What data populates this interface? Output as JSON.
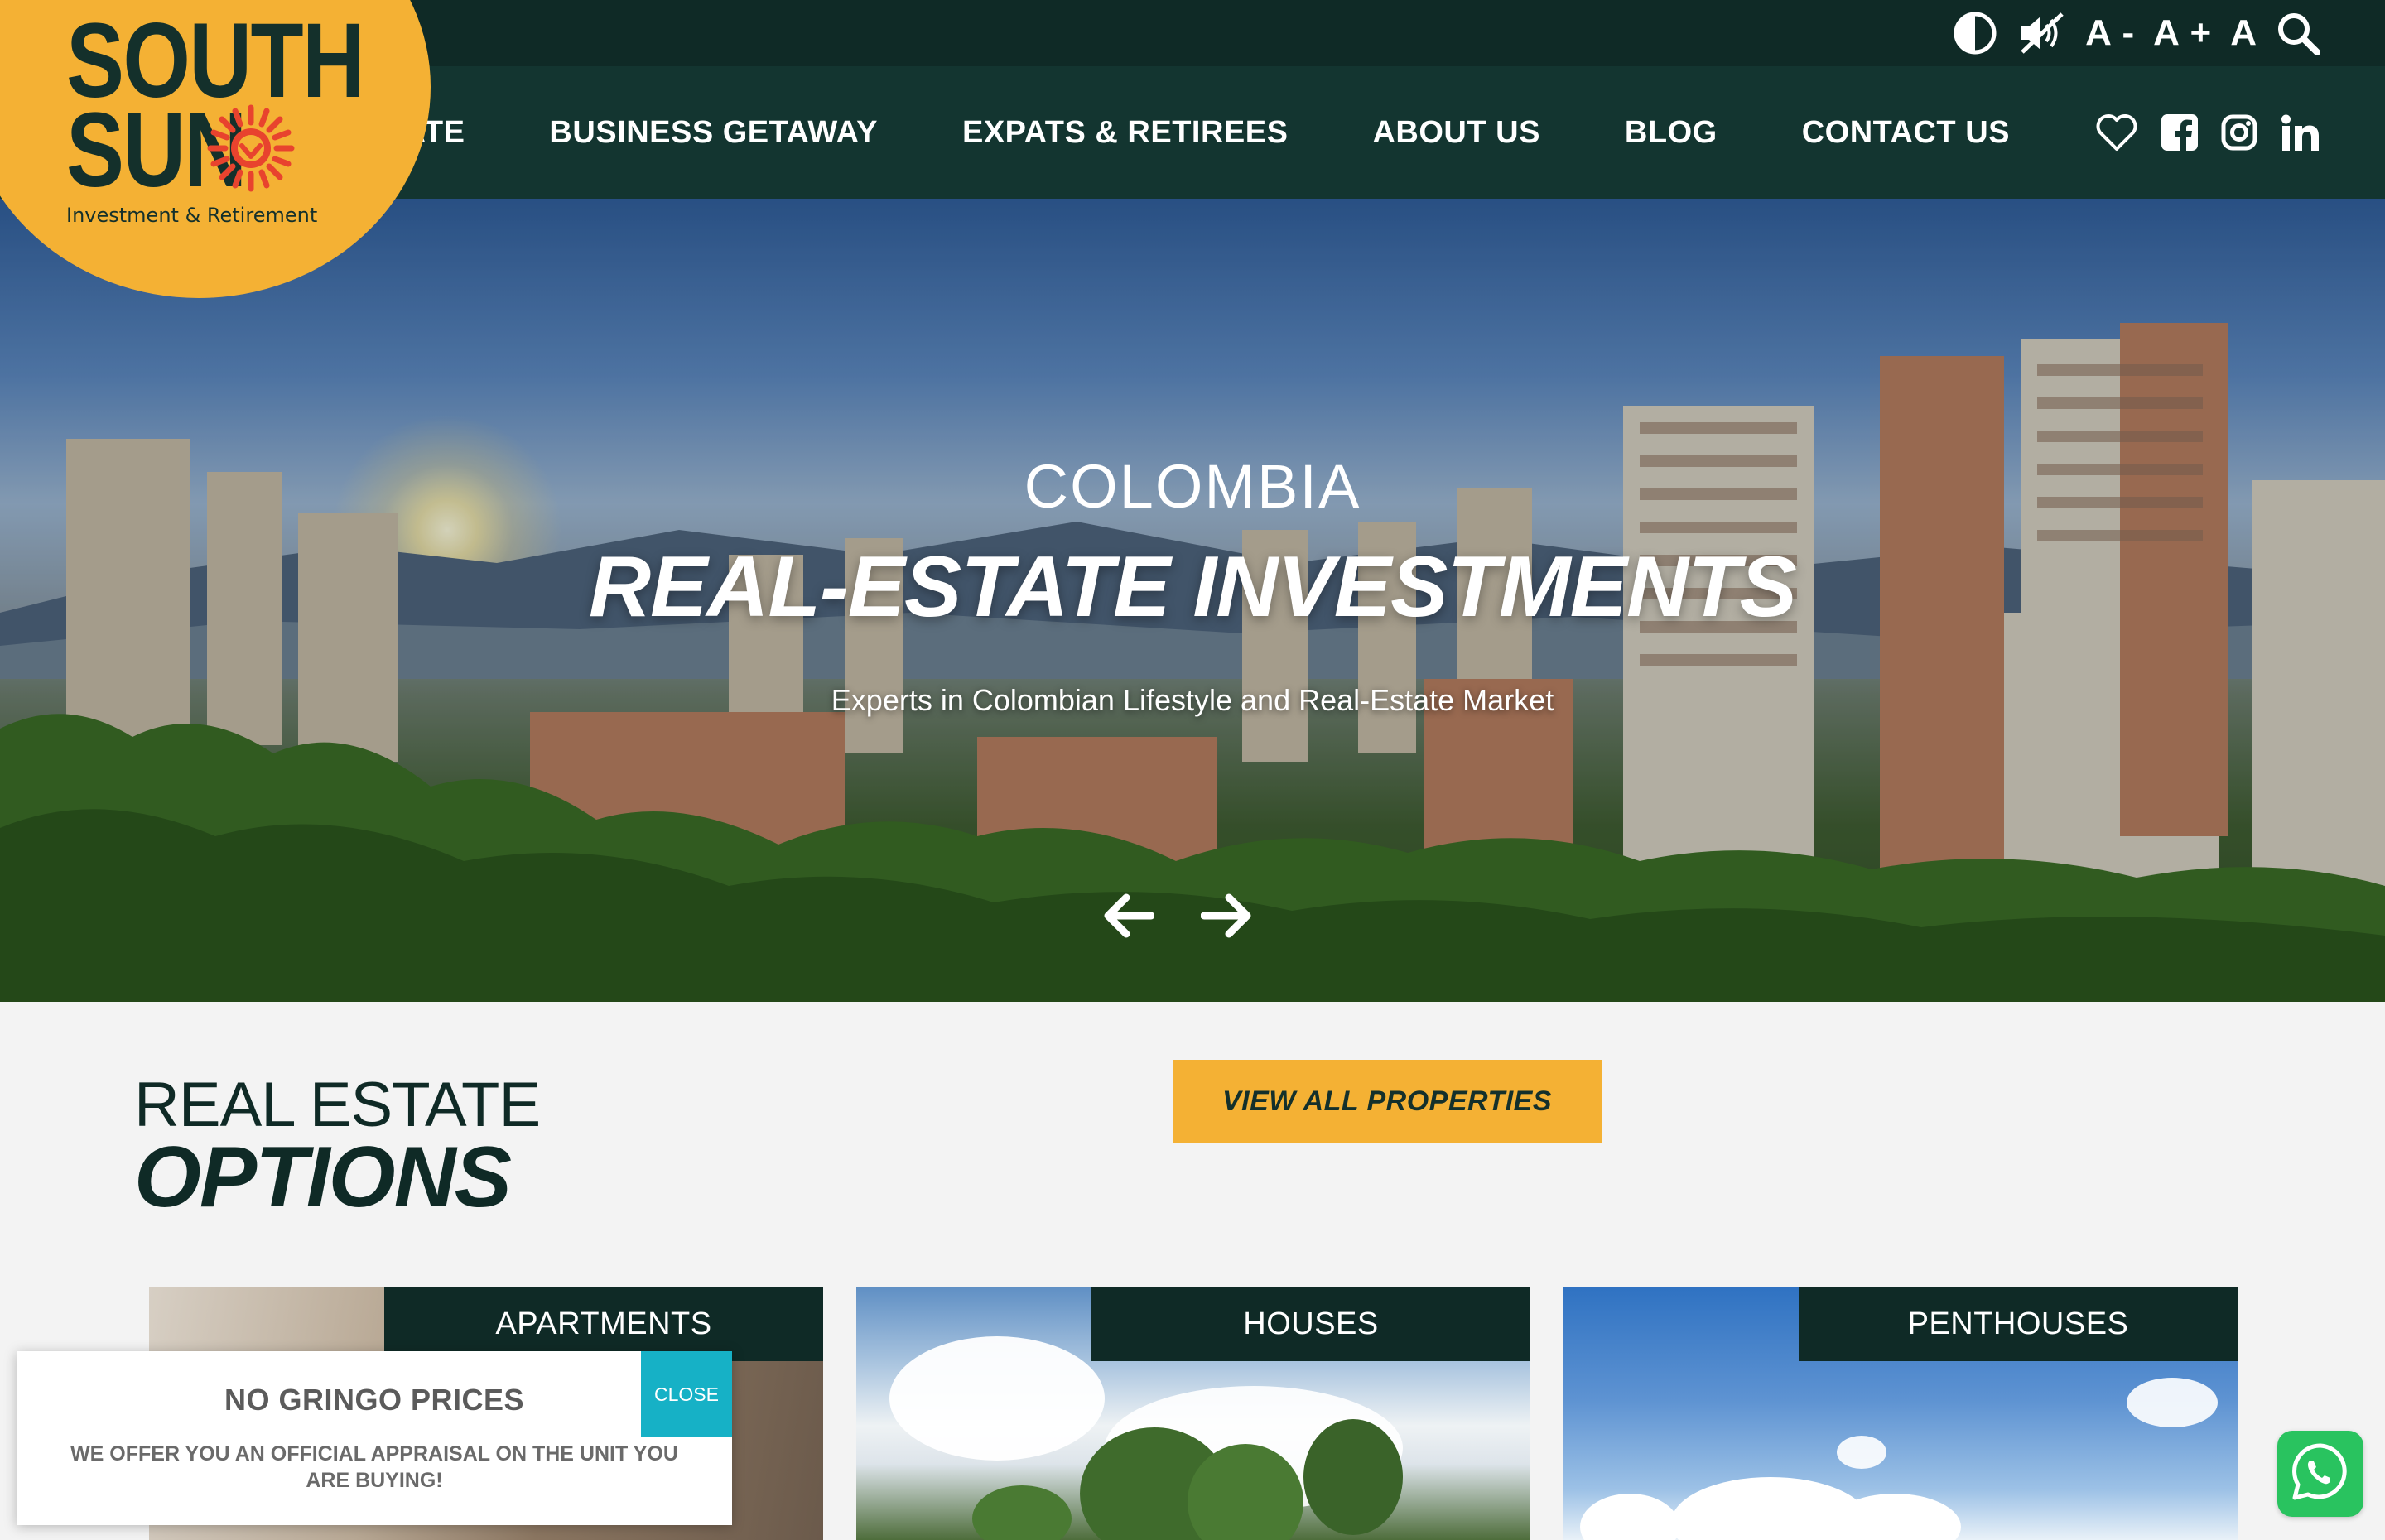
{
  "brand": {
    "line1": "SOUTH",
    "line2": "SUN",
    "tagline": "Investment & Retirement"
  },
  "utility": {
    "font_decrease": "A -",
    "font_increase": "A +",
    "font_reset": "A"
  },
  "nav": {
    "items": [
      {
        "label": "STATE"
      },
      {
        "label": "BUSINESS GETAWAY"
      },
      {
        "label": "EXPATS & RETIREES"
      },
      {
        "label": "ABOUT US"
      },
      {
        "label": "BLOG"
      },
      {
        "label": "CONTACT US"
      }
    ]
  },
  "hero": {
    "kicker": "COLOMBIA",
    "title": "REAL-ESTATE INVESTMENTS",
    "subtitle": "Experts in Colombian Lifestyle and Real-Estate Market"
  },
  "options": {
    "heading_line1": "REAL ESTATE",
    "heading_line2": "OPTIONS",
    "view_all": "VIEW ALL PROPERTIES",
    "cards": [
      {
        "label": "APARTMENTS"
      },
      {
        "label": "HOUSES"
      },
      {
        "label": "PENTHOUSES"
      }
    ]
  },
  "popup": {
    "title": "NO GRINGO PRICES",
    "body": "WE OFFER YOU AN OFFICIAL APPRAISAL ON THE UNIT YOU ARE BUYING!",
    "close": "CLOSE"
  },
  "colors": {
    "dark_green": "#0f2a26",
    "nav_green": "#133530",
    "accent_yellow": "#f4b134",
    "close_teal": "#16b1c6",
    "whatsapp_green": "#29c35f"
  }
}
